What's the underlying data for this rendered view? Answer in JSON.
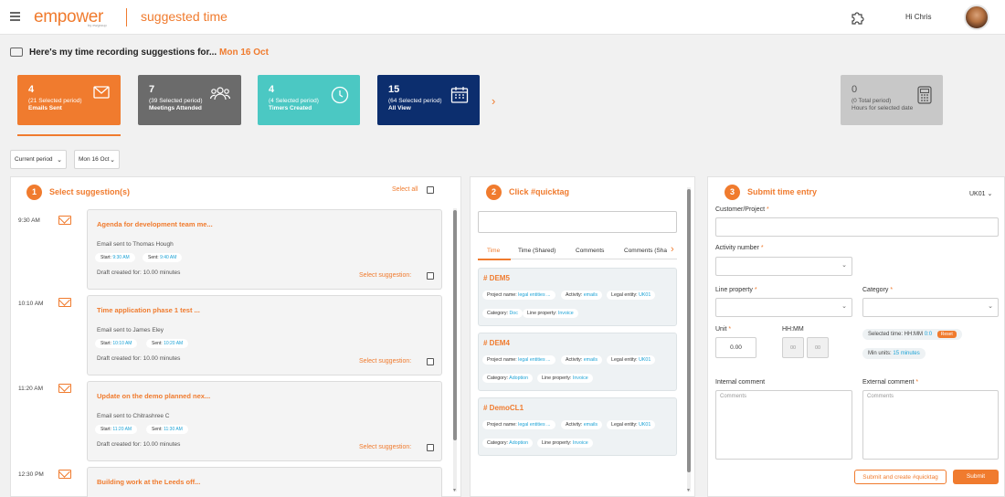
{
  "header": {
    "logo": "empower",
    "logo_sub": "by ewgroup",
    "page_title": "suggested time",
    "greeting": "Hi Chris"
  },
  "intro": {
    "text": "Here's my time recording suggestions for...",
    "date": "Mon 16 Oct"
  },
  "cards": [
    {
      "num": "4",
      "sub": "(21 Selected period)",
      "label": "Emails Sent",
      "color": "#f07b2e",
      "icon": "envelope-icon"
    },
    {
      "num": "7",
      "sub": "(39 Selected period)",
      "label": "Meetings Attended",
      "color": "#6b6b6b",
      "icon": "people-icon"
    },
    {
      "num": "4",
      "sub": "(4 Selected period)",
      "label": "Timers Created",
      "color": "#4bc8c3",
      "icon": "clock-icon"
    },
    {
      "num": "15",
      "sub": "(64 Selected period)",
      "label": "All View",
      "color": "#0c2e6e",
      "icon": "calendar-icon"
    }
  ],
  "hours_card": {
    "num": "0",
    "sub": "(0 Total period)",
    "label": "Hours for selected date",
    "color": "#c8c8c8",
    "icon": "calculator-icon"
  },
  "filters": {
    "period": "Current period",
    "date": "Mon 16 Oct"
  },
  "panel1": {
    "step": "1",
    "title": "Select suggestion(s)",
    "select_all": "Select all",
    "items": [
      {
        "time": "9:30 AM",
        "title": "Agenda for development team me...",
        "who": "Email sent to Thomas Hough",
        "start_label": "Start:",
        "start": "9:30 AM",
        "sent_label": "Sent:",
        "sent": "9:40 AM",
        "draft": "Draft created for: 10.00 minutes",
        "select": "Select suggestion:"
      },
      {
        "time": "10:10 AM",
        "title": "Time application phase 1 test ...",
        "who": "Email sent to James Eley",
        "start_label": "Start:",
        "start": "10:10 AM",
        "sent_label": "Sent:",
        "sent": "10:20 AM",
        "draft": "Draft created for: 10.00 minutes",
        "select": "Select suggestion:"
      },
      {
        "time": "11:20 AM",
        "title": "Update on the demo planned nex...",
        "who": "Email sent to Chitrashree C",
        "start_label": "Start:",
        "start": "11:20 AM",
        "sent_label": "Sent:",
        "sent": "11:30 AM",
        "draft": "Draft created for: 10.00 minutes",
        "select": "Select suggestion:"
      },
      {
        "time": "12:30 PM",
        "title": "Building work at the Leeds off...",
        "who": "",
        "start_label": "",
        "start": "",
        "sent_label": "",
        "sent": "",
        "draft": "",
        "select": ""
      }
    ]
  },
  "panel2": {
    "step": "2",
    "title": "Click #quicktag",
    "tabs": [
      "Time",
      "Time (Shared)",
      "Comments",
      "Comments (Sha"
    ],
    "tags": [
      {
        "name": "# DEM5",
        "project_label": "Project name:",
        "project": "legal entities ...",
        "activity_label": "Activity:",
        "activity": "emails",
        "entity_label": "Legal entity:",
        "entity": "UK01",
        "category_label": "Category:",
        "category": "Doc",
        "line_label": "Line property:",
        "line": "Invoice"
      },
      {
        "name": "# DEM4",
        "project_label": "Project name:",
        "project": "legal entities ...",
        "activity_label": "Activity:",
        "activity": "emails",
        "entity_label": "Legal entity:",
        "entity": "UK01",
        "category_label": "Category:",
        "category": "Adoption",
        "line_label": "Line property:",
        "line": "Invoice"
      },
      {
        "name": "# DemoCL1",
        "project_label": "Project name:",
        "project": "legal entities ...",
        "activity_label": "Activity:",
        "activity": "emails",
        "entity_label": "Legal entity:",
        "entity": "UK01",
        "category_label": "Category:",
        "category": "Adoption",
        "line_label": "Line property:",
        "line": "Invoice"
      }
    ]
  },
  "panel3": {
    "step": "3",
    "title": "Submit time entry",
    "entity": "UK01",
    "customer_label": "Customer/Project",
    "activity_label": "Activity number",
    "line_label": "Line property",
    "category_label": "Category",
    "unit_label": "Unit",
    "unit_value": "0.00",
    "hhmm_label": "HH:MM",
    "hh_placeholder": "00",
    "mm_placeholder": "00",
    "selected_time_label": "Selected time: HH:MM",
    "selected_time_value": "0:0",
    "reset_label": "Reset",
    "min_units_label": "Min units:",
    "min_units_value": "15 minutes",
    "internal_label": "Internal comment",
    "external_label": "External comment",
    "comments_placeholder": "Comments",
    "submit_quicktag": "Submit and create #quicktag",
    "submit": "Submit",
    "required": "*"
  }
}
